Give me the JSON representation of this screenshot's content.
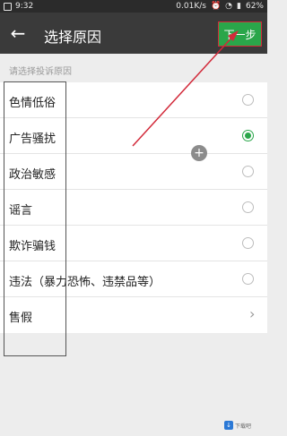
{
  "status_bar": {
    "time": "9:32",
    "network": "0.01K/s",
    "battery": "62%"
  },
  "header": {
    "back_icon": "arrow-left-icon",
    "title": "选择原因",
    "next_label": "下一步"
  },
  "section_label": "请选择投诉原因",
  "reasons": [
    {
      "label": "色情低俗",
      "control": "radio",
      "selected": false
    },
    {
      "label": "广告骚扰",
      "control": "radio",
      "selected": true
    },
    {
      "label": "政治敏感",
      "control": "radio",
      "selected": false
    },
    {
      "label": "谣言",
      "control": "radio",
      "selected": false
    },
    {
      "label": "欺诈骗钱",
      "control": "radio",
      "selected": false
    },
    {
      "label": "违法（暴力恐怖、违禁品等）",
      "control": "radio",
      "selected": false
    },
    {
      "label": "售假",
      "control": "chevron",
      "selected": false
    }
  ],
  "colors": {
    "accent_green": "#2aa64a",
    "annotation_red": "#d22a3a",
    "appbar": "#3a3a3a"
  },
  "watermark": "下载吧"
}
